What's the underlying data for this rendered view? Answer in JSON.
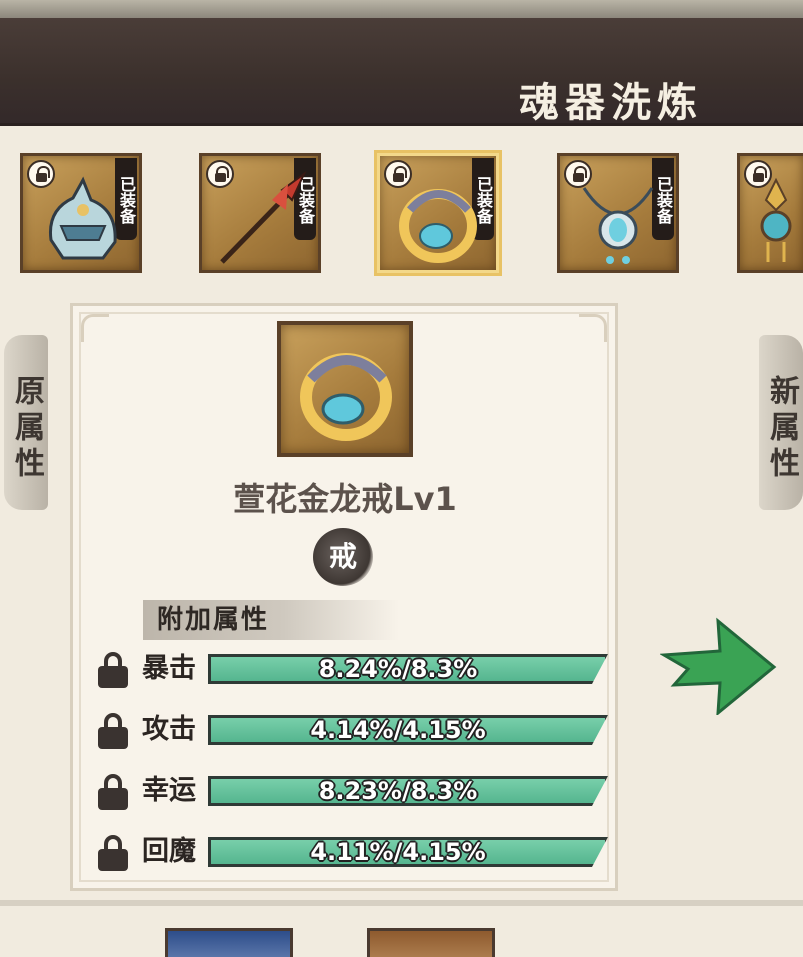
{
  "title": "魂器洗炼",
  "equip_slots": [
    {
      "name": "helmet",
      "equipped_label": "已装备",
      "icon": "helmet-icon",
      "locked": true,
      "selected": false
    },
    {
      "name": "spear",
      "equipped_label": "已装备",
      "icon": "spear-icon",
      "locked": true,
      "selected": false
    },
    {
      "name": "ring",
      "equipped_label": "已装备",
      "icon": "ring-icon",
      "locked": true,
      "selected": true
    },
    {
      "name": "necklace",
      "equipped_label": "已装备",
      "icon": "necklace-icon",
      "locked": true,
      "selected": false
    },
    {
      "name": "pendant",
      "equipped_label": "",
      "icon": "pendant-icon",
      "locked": true,
      "selected": false
    }
  ],
  "tabs": {
    "original": "原属性",
    "new": "新属性"
  },
  "item": {
    "name": "萱花金龙戒Lv1",
    "type": "戒",
    "icon": "ring-icon"
  },
  "attributes": {
    "header": "附加属性",
    "rows": [
      {
        "name": "暴击",
        "value": "8.24%/8.3%",
        "fill": 0.993
      },
      {
        "name": "攻击",
        "value": "4.14%/4.15%",
        "fill": 0.998
      },
      {
        "name": "幸运",
        "value": "8.23%/8.3%",
        "fill": 0.992
      },
      {
        "name": "回魔",
        "value": "4.11%/4.15%",
        "fill": 0.99
      }
    ]
  },
  "colors": {
    "title_bar": "#3b302c",
    "bar_fill": "#62c29c",
    "arrow": "#3aa354",
    "selected_border": "#e8c265"
  }
}
